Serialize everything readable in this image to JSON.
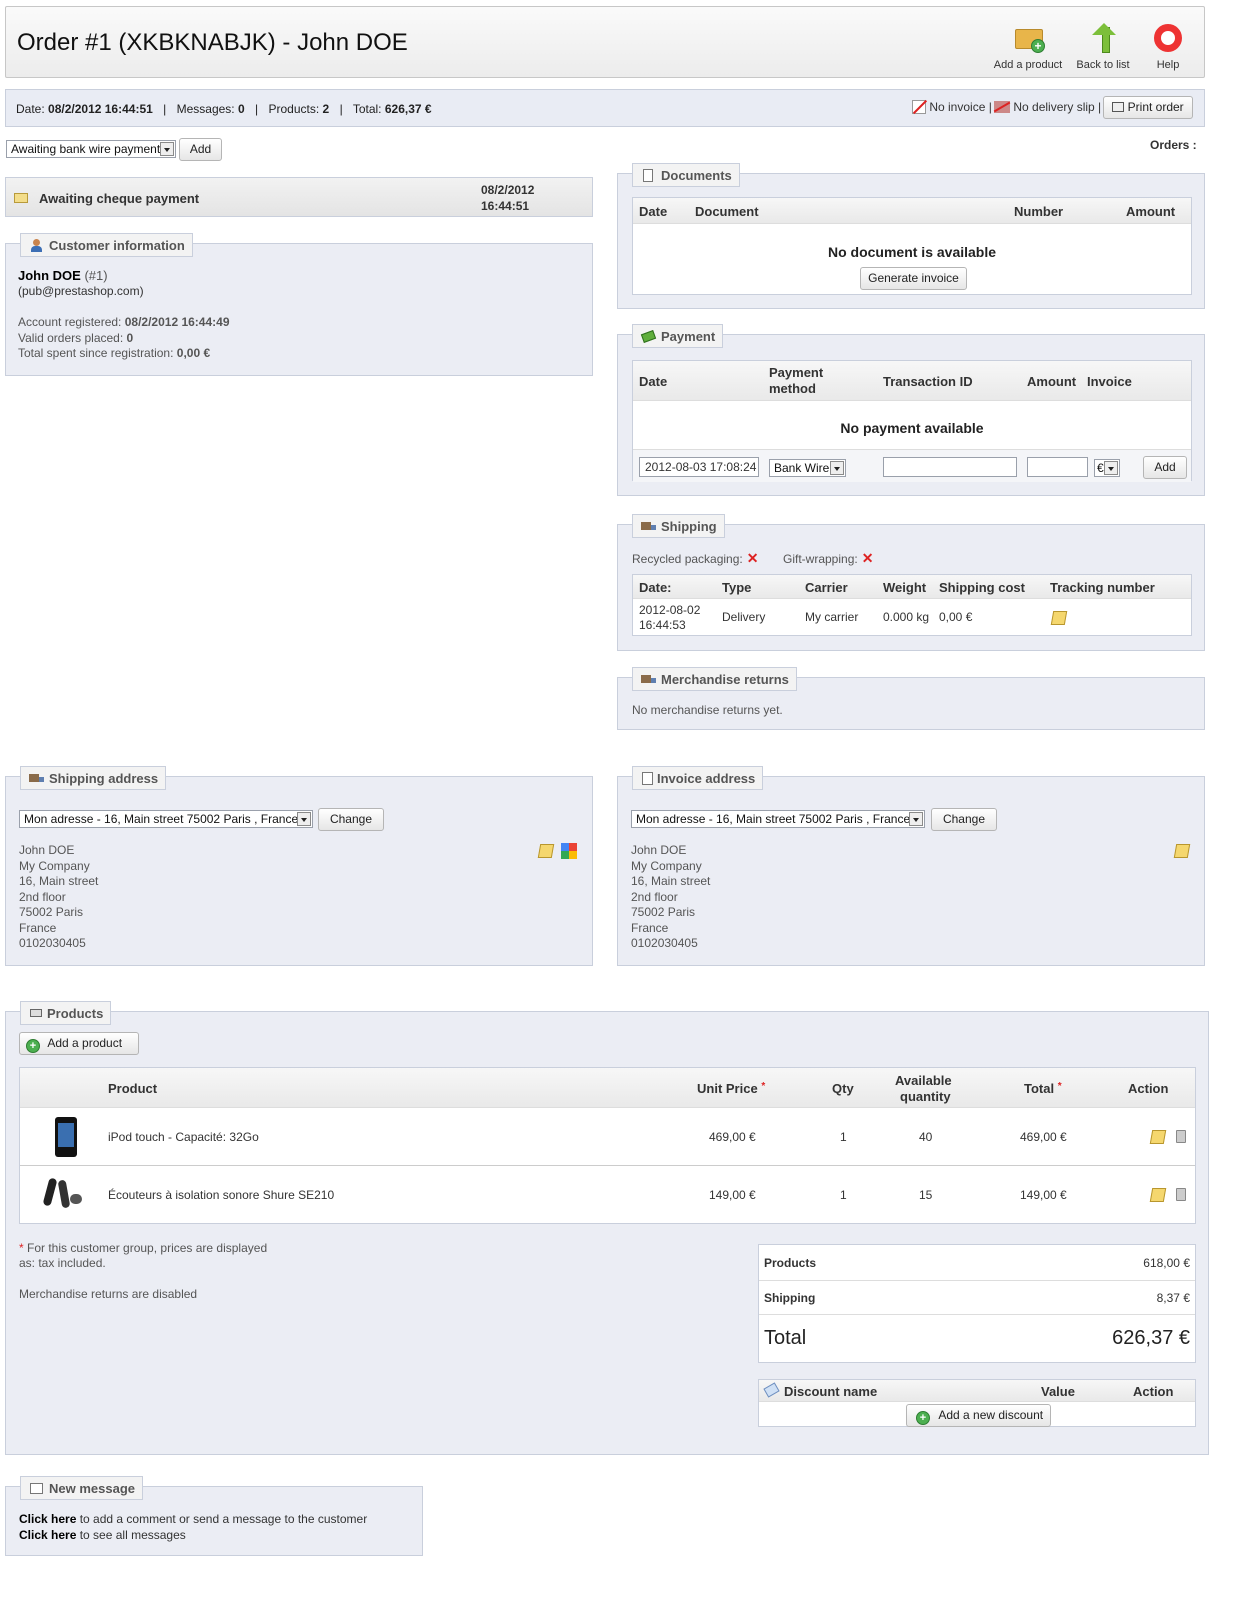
{
  "header": {
    "title": "Order #1 (XKBKNABJK) - John DOE",
    "toolbar": {
      "add_product": "Add a product",
      "back_to_list": "Back to list",
      "help": "Help"
    }
  },
  "summary": {
    "date_label": "Date:",
    "date": "08/2/2012 16:44:51",
    "messages_label": "Messages:",
    "messages": "0",
    "products_label": "Products:",
    "products": "2",
    "total_label": "Total:",
    "total": "626,37 €",
    "no_invoice": "No invoice |",
    "no_delivery": "No delivery slip |",
    "print_order": "Print order"
  },
  "status": {
    "select_value": "Awaiting bank wire payment",
    "add_label": "Add",
    "current": "Awaiting cheque payment",
    "date_line1": "08/2/2012",
    "date_line2": "16:44:51"
  },
  "orders_label": "Orders :",
  "customer": {
    "legend": "Customer information",
    "name": "John DOE",
    "id": "(#1)",
    "email": "(pub@prestashop.com)",
    "registered_label": "Account registered:",
    "registered": "08/2/2012 16:44:49",
    "valid_orders_label": "Valid orders placed:",
    "valid_orders": "0",
    "total_spent_label": "Total spent since registration:",
    "total_spent": "0,00 €"
  },
  "documents": {
    "legend": "Documents",
    "headers": [
      "Date",
      "Document",
      "Number",
      "Amount"
    ],
    "empty": "No document is available",
    "generate": "Generate invoice"
  },
  "payment": {
    "legend": "Payment",
    "h_date": "Date",
    "h_method_1": "Payment",
    "h_method_2": "method",
    "h_txn": "Transaction ID",
    "h_amount": "Amount",
    "h_invoice": "Invoice",
    "empty": "No payment available",
    "date_value": "2012-08-03 17:08:24",
    "method_value": "Bank Wire",
    "currency": "€",
    "add_label": "Add"
  },
  "shipping": {
    "legend": "Shipping",
    "recycled": "Recycled packaging:",
    "gift": "Gift-wrapping:",
    "headers": [
      "Date:",
      "Type",
      "Carrier",
      "Weight",
      "Shipping cost",
      "Tracking number"
    ],
    "row": {
      "date1": "2012-08-02",
      "date2": "16:44:53",
      "type": "Delivery",
      "carrier": "My carrier",
      "weight": "0.000 kg",
      "cost": "0,00 €"
    }
  },
  "returns": {
    "legend": "Merchandise returns",
    "empty": "No merchandise returns yet."
  },
  "shipping_address": {
    "legend": "Shipping address",
    "select_value": "Mon adresse - 16, Main street 75002 Paris , France",
    "change": "Change",
    "lines": [
      "John DOE",
      "My Company",
      "16, Main street",
      "2nd floor",
      "75002 Paris",
      "France",
      "0102030405"
    ]
  },
  "invoice_address": {
    "legend": "Invoice address",
    "select_value": "Mon adresse - 16, Main street 75002 Paris , France",
    "change": "Change",
    "lines": [
      "John DOE",
      "My Company",
      "16, Main street",
      "2nd floor",
      "75002 Paris",
      "France",
      "0102030405"
    ]
  },
  "products": {
    "legend": "Products",
    "add_product": "Add a product",
    "h_product": "Product",
    "h_unit": "Unit Price",
    "h_qty": "Qty",
    "h_avail_1": "Available",
    "h_avail_2": "quantity",
    "h_total": "Total",
    "h_action": "Action",
    "star": "*",
    "rows": [
      {
        "name": "iPod touch - Capacité: 32Go",
        "unit": "469,00 €",
        "qty": "1",
        "avail": "40",
        "total": "469,00 €"
      },
      {
        "name": "Écouteurs à isolation sonore Shure SE210",
        "unit": "149,00 €",
        "qty": "1",
        "avail": "15",
        "total": "149,00 €"
      }
    ],
    "note_1": "For this customer group, prices are displayed",
    "note_2": "as: tax included.",
    "returns_disabled": "Merchandise returns are disabled",
    "totals": {
      "products_label": "Products",
      "products": "618,00 €",
      "shipping_label": "Shipping",
      "shipping": "8,37 €",
      "total_label": "Total",
      "total": "626,37 €"
    },
    "discount": {
      "h_name": "Discount name",
      "h_value": "Value",
      "h_action": "Action",
      "add": "Add a new discount"
    }
  },
  "message": {
    "legend": "New message",
    "click_here": "Click here",
    "line1": " to add a comment or send a message to the customer",
    "line2": " to see all messages"
  }
}
